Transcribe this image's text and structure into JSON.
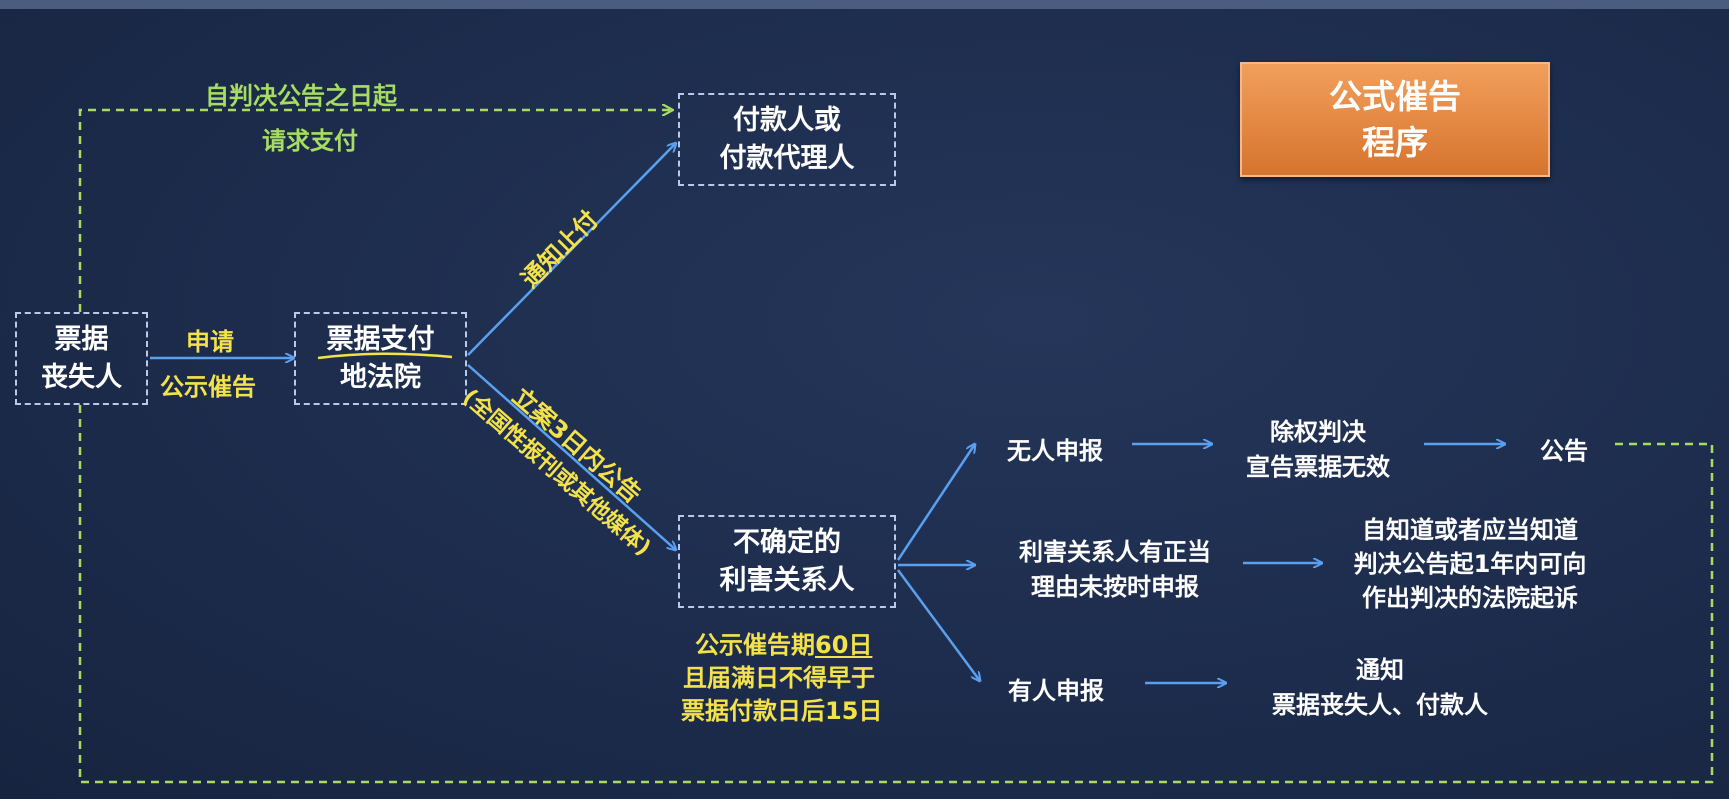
{
  "title": {
    "line1": "公式催告",
    "line2": "程序"
  },
  "nodes": {
    "loser": {
      "line1": "票据",
      "line2": "丧失人"
    },
    "court": {
      "line1": "票据支付",
      "line2": "地法院"
    },
    "payer": {
      "line1": "付款人或",
      "line2": "付款代理人"
    },
    "interested": {
      "line1": "不确定的",
      "line2": "利害关系人"
    }
  },
  "edges": {
    "apply_line1": "申请",
    "apply_line2": "公示催告",
    "request_line1": "自判决公告之日起",
    "request_line2": "请求支付",
    "notify_stop": "通知止付",
    "announce_line1": "立案3日内公告",
    "announce_line2": "(全国性报刊或其他媒体)"
  },
  "period": {
    "line1_prefix": "公示催告期",
    "line1_days": "60日",
    "line2": "且届满日不得早于",
    "line3": "票据付款日后15日"
  },
  "outcomes": {
    "none": "无人申报",
    "judgment_line1": "除权判决",
    "judgment_line2": "宣告票据无效",
    "announce": "公告",
    "late_line1": "利害关系人有正当",
    "late_line2": "理由未按时申报",
    "sue_line1": "自知道或者应当知道",
    "sue_line2": "判决公告起1年内可向",
    "sue_line3": "作出判决的法院起诉",
    "someone": "有人申报",
    "notify_line1": "通知",
    "notify_line2": "票据丧失人、付款人"
  },
  "colors": {
    "background": "#1d2c4c",
    "arrow_blue": "#5aa0f0",
    "dashed_green": "#a7dc63",
    "label_yellow": "#f3e24a",
    "title_orange": "#e5883f"
  }
}
